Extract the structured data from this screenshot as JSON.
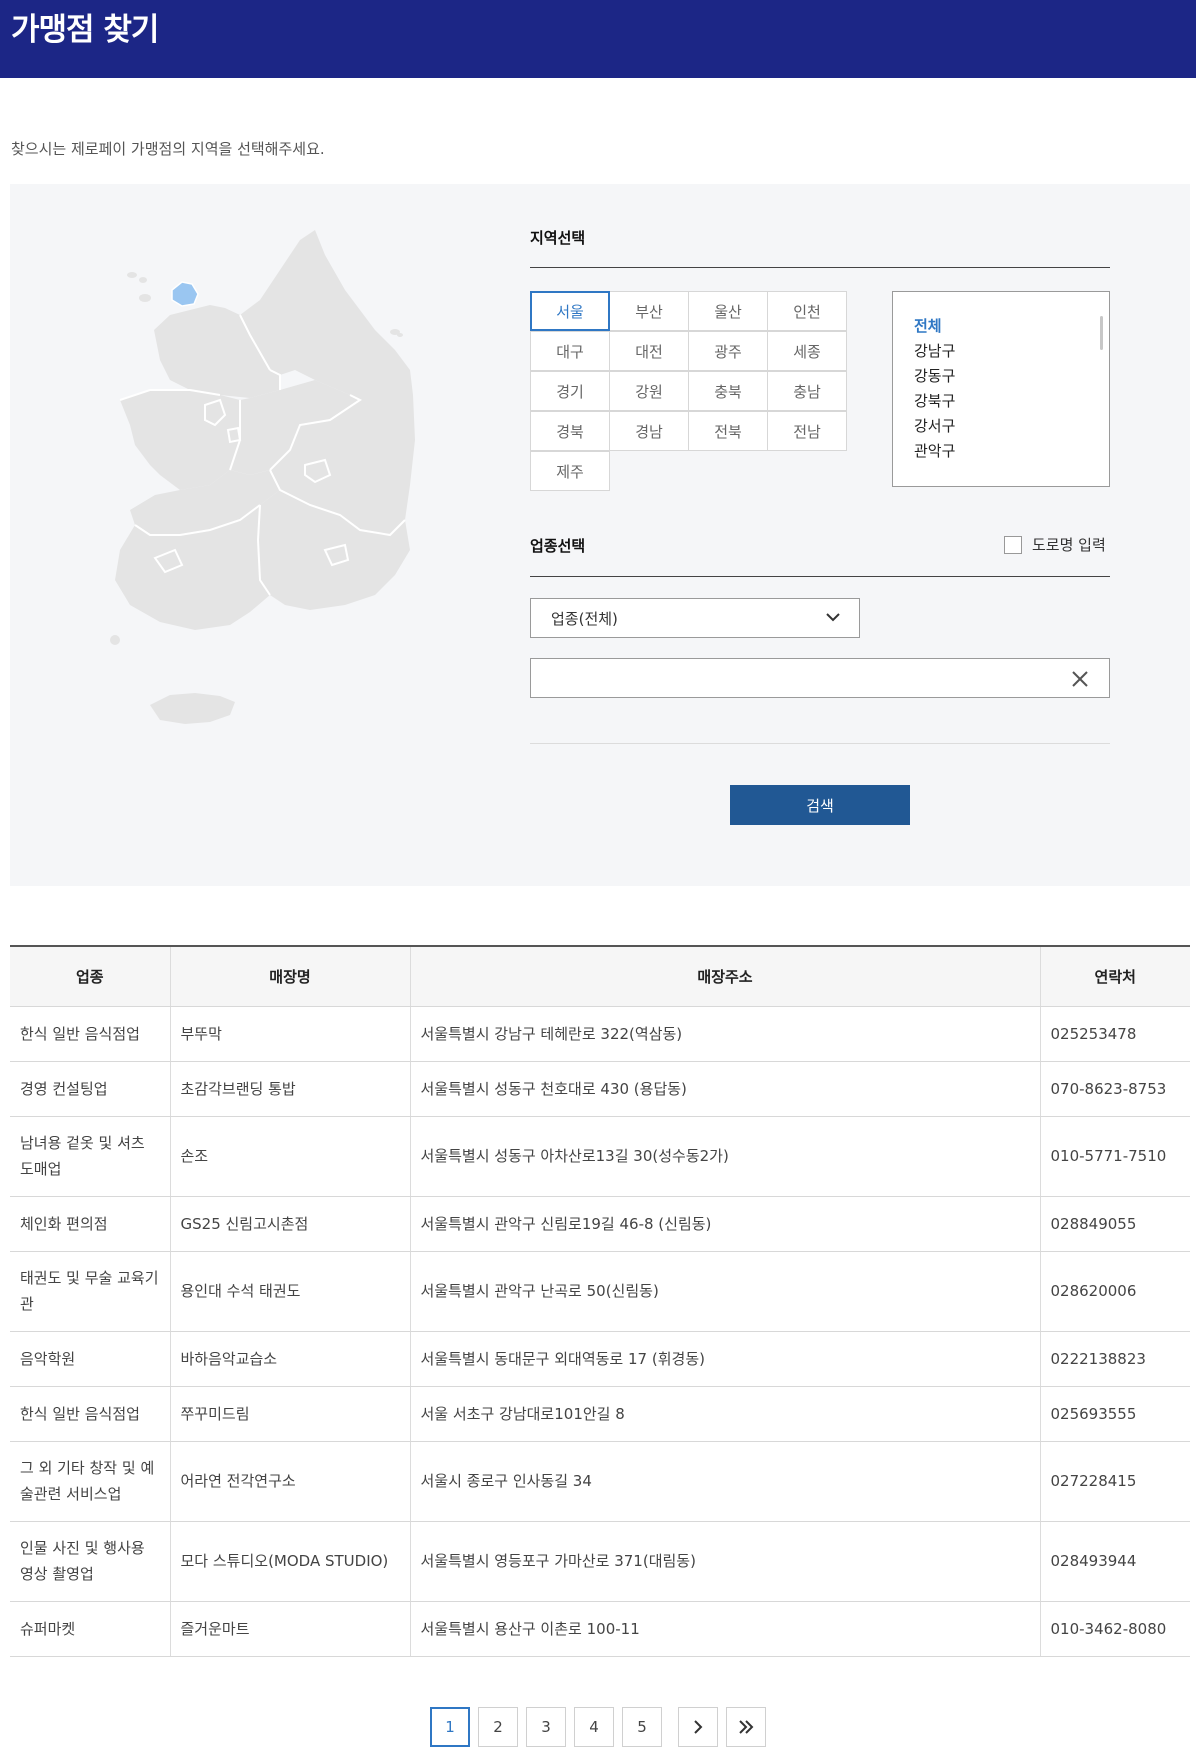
{
  "page": {
    "title": "가맹점 찾기",
    "intro": "찾으시는 제로페이 가맹점의 지역을 선택해주세요."
  },
  "region_section": {
    "title": "지역선택",
    "regions": [
      "서울",
      "부산",
      "울산",
      "인천",
      "대구",
      "대전",
      "광주",
      "세종",
      "경기",
      "강원",
      "충북",
      "충남",
      "경북",
      "경남",
      "전북",
      "전남",
      "제주"
    ],
    "selected": "서울",
    "districts": [
      "전체",
      "강남구",
      "강동구",
      "강북구",
      "강서구",
      "관악구"
    ],
    "selected_district": "전체"
  },
  "business_section": {
    "title": "업종선택",
    "road_name_label": "도로명 입력",
    "road_name_checked": false,
    "select_value": "업종(전체)",
    "keyword_value": "",
    "search_label": "검색"
  },
  "colors": {
    "header_bg": "#1c2686",
    "accent": "#2f77c4",
    "search_button": "#215894",
    "map_land": "#e4e4e4",
    "map_selected": "#9ac6f1"
  },
  "icons": {
    "select_arrow": "chevron-down-icon",
    "clear": "close-icon",
    "next": "chevron-right-icon",
    "last": "double-chevron-right-icon"
  },
  "table": {
    "headers": [
      "업종",
      "매장명",
      "매장주소",
      "연락처"
    ],
    "rows": [
      [
        "한식 일반 음식점업",
        "부뚜막",
        "서울특별시 강남구 테헤란로 322(역삼동)",
        "025253478"
      ],
      [
        "경영 컨설팅업",
        "초감각브랜딩 통밥",
        "서울특별시 성동구 천호대로 430 (용답동)",
        "070-8623-8753"
      ],
      [
        "남녀용 겉옷 및 셔츠 도매업",
        "손조",
        "서울특별시 성동구 아차산로13길 30(성수동2가)",
        "010-5771-7510"
      ],
      [
        "체인화 편의점",
        "GS25 신림고시촌점",
        "서울특별시 관악구 신림로19길 46-8 (신림동)",
        "028849055"
      ],
      [
        "태권도 및 무술 교육기관",
        "용인대 수석 태권도",
        "서울특별시 관악구 난곡로 50(신림동)",
        "028620006"
      ],
      [
        "음악학원",
        "바하음악교습소",
        "서울특별시 동대문구 외대역동로 17 (휘경동)",
        "0222138823"
      ],
      [
        "한식 일반 음식점업",
        "쭈꾸미드림",
        "서울 서초구 강남대로101안길 8",
        "025693555"
      ],
      [
        "그 외 기타 창작 및 예술관련 서비스업",
        "어라연 전각연구소",
        "서울시 종로구 인사동길 34",
        "027228415"
      ],
      [
        "인물 사진 및 행사용 영상 촬영업",
        "모다 스튜디오(MODA STUDIO)",
        "서울특별시 영등포구 가마산로 371(대림동)",
        "028493944"
      ],
      [
        "슈퍼마켓",
        "즐거운마트",
        "서울특별시 용산구 이촌로 100-11",
        "010-3462-8080"
      ]
    ]
  },
  "pagination": {
    "pages": [
      "1",
      "2",
      "3",
      "4",
      "5"
    ],
    "current": "1"
  }
}
